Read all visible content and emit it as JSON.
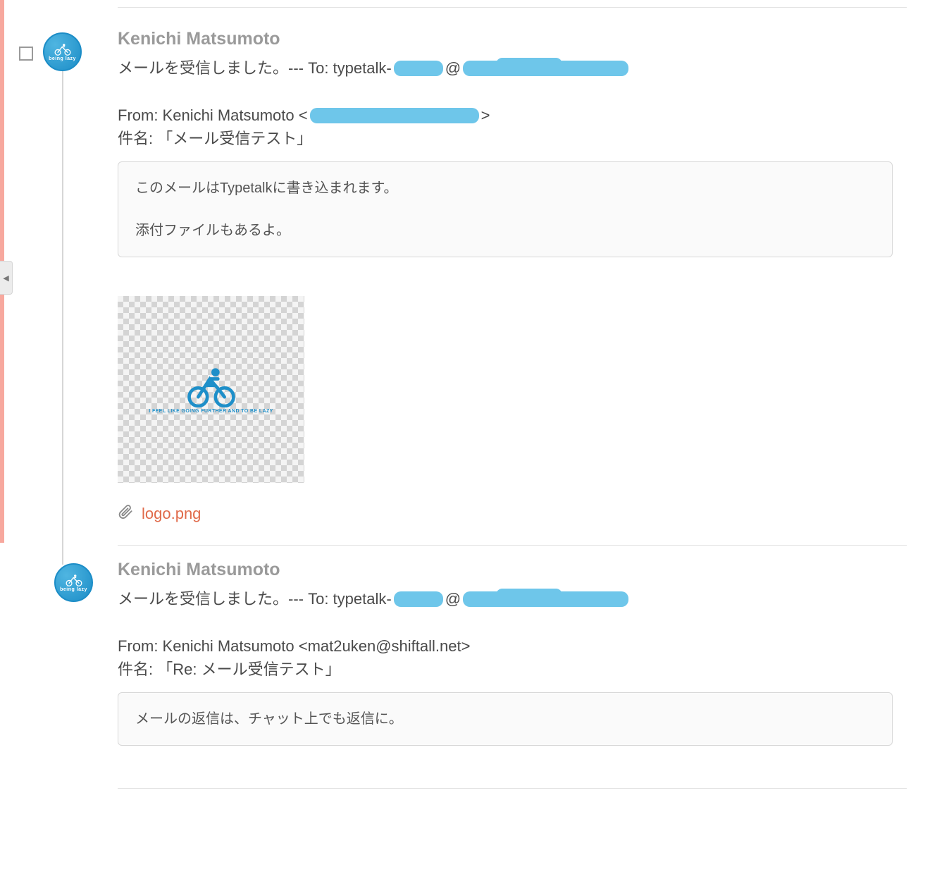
{
  "messages": [
    {
      "author": "Kenichi Matsumoto",
      "avatar_label": "being lazy",
      "line1_prefix": "メールを受信しました。--- To: typetalk-",
      "line1_at": "@",
      "from_prefix": "From: Kenichi Matsumoto <",
      "from_suffix": ">",
      "subject": "件名: 「メール受信テスト」",
      "quote_line1": "このメールはTypetalkに書き込まれます。",
      "quote_line2": "添付ファイルもあるよ。",
      "preview_caption": "I FEEL LIKE GOING FURTHER AND TO BE LAZY",
      "attachment_name": "logo.png"
    },
    {
      "author": "Kenichi Matsumoto",
      "avatar_label": "being lazy",
      "line1_prefix": "メールを受信しました。--- To: typetalk-",
      "line1_at": "@",
      "from_full": "From: Kenichi Matsumoto <mat2uken@shiftall.net>",
      "subject": "件名: 「Re: メール受信テスト」",
      "quote_line1": "メールの返信は、チャット上でも返信に。"
    }
  ]
}
